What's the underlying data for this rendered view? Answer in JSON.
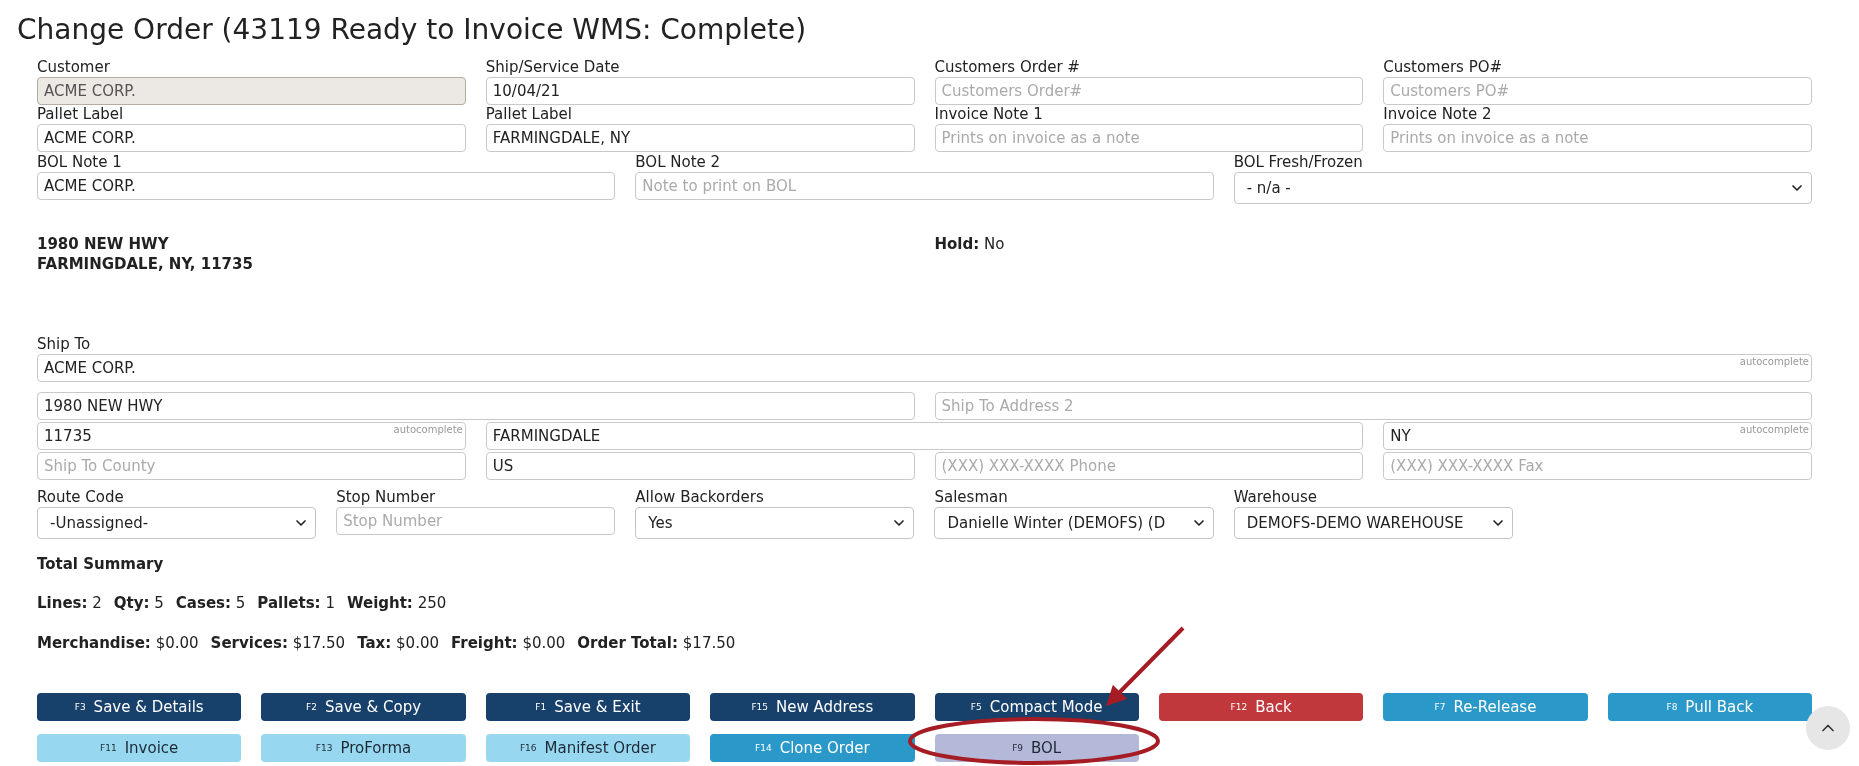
{
  "title": "Change Order (43119 Ready to Invoice WMS: Complete)",
  "form_rows": [
    {
      "fields": [
        {
          "kind": "input",
          "label": "Customer",
          "value": "ACME CORP.",
          "disabled": true
        },
        {
          "kind": "input",
          "label": "Ship/Service Date",
          "value": "10/04/21",
          "disabled": false
        },
        {
          "kind": "input",
          "label": "Customers Order #",
          "placeholder": "Customers Order#",
          "disabled": false
        },
        {
          "kind": "input",
          "label": "Customers PO#",
          "placeholder": "Customers PO#",
          "disabled": false
        }
      ]
    },
    {
      "fields": [
        {
          "kind": "input",
          "label": "Pallet Label",
          "value": "ACME CORP."
        },
        {
          "kind": "input",
          "label": "Pallet Label",
          "value": "FARMINGDALE, NY"
        },
        {
          "kind": "input",
          "label": "Invoice Note 1",
          "placeholder": "Prints on invoice as a note"
        },
        {
          "kind": "input",
          "label": "Invoice Note 2",
          "placeholder": "Prints on invoice as a note"
        }
      ]
    },
    {
      "fields": [
        {
          "kind": "input",
          "label": "BOL Note 1",
          "value": "ACME CORP."
        },
        {
          "kind": "input",
          "label": "BOL Note 2",
          "placeholder": "Note to print on BOL"
        },
        {
          "kind": "select",
          "label": "BOL Fresh/Frozen",
          "value": "- n/a -"
        }
      ]
    }
  ],
  "address": {
    "lines": [
      "1980 NEW HWY",
      "FARMINGDALE, NY, 11735"
    ]
  },
  "hold": {
    "label": "Hold:",
    "value": "No"
  },
  "ship_to": {
    "label": "Ship To",
    "rows": [
      {
        "fields": [
          {
            "kind": "input",
            "value": "ACME CORP.",
            "hint": "autocomplete"
          }
        ]
      },
      {
        "fields": [
          {
            "kind": "input",
            "value": "1980 NEW HWY"
          },
          {
            "kind": "input",
            "placeholder": "Ship To Address 2"
          }
        ]
      },
      {
        "fields": [
          {
            "kind": "input",
            "value": "11735",
            "hint": "autocomplete"
          },
          {
            "kind": "input",
            "value": "FARMINGDALE"
          },
          {
            "kind": "input",
            "value": "NY",
            "hint": "autocomplete"
          }
        ]
      },
      {
        "fields": [
          {
            "kind": "input",
            "placeholder": "Ship To County"
          },
          {
            "kind": "input",
            "value": "US"
          },
          {
            "kind": "input",
            "placeholder": "(XXX) XXX-XXXX Phone"
          },
          {
            "kind": "input",
            "placeholder": "(XXX) XXX-XXXX Fax"
          }
        ]
      }
    ]
  },
  "options_row": {
    "fields": [
      {
        "kind": "select",
        "label": "Route Code",
        "value": "-Unassigned-"
      },
      {
        "kind": "input",
        "label": "Stop Number",
        "placeholder": "Stop Number"
      },
      {
        "kind": "select",
        "label": "Allow Backorders",
        "value": "Yes"
      },
      {
        "kind": "select",
        "label": "Salesman",
        "value": "Danielle Winter (DEMOFS) (D"
      },
      {
        "kind": "select",
        "label": "Warehouse",
        "value": "DEMOFS-DEMO WAREHOUSE"
      }
    ]
  },
  "summary": {
    "title": "Total Summary",
    "lines": [
      {
        "items": [
          {
            "label": "Lines:",
            "value": "2"
          },
          {
            "label": "Qty:",
            "value": "5"
          },
          {
            "label": "Cases:",
            "value": "5"
          },
          {
            "label": "Pallets:",
            "value": "1"
          },
          {
            "label": "Weight:",
            "value": "250"
          }
        ]
      },
      {
        "items": [
          {
            "label": "Merchandise:",
            "value": "$0.00"
          },
          {
            "label": "Services:",
            "value": "$17.50"
          },
          {
            "label": "Tax:",
            "value": "$0.00"
          },
          {
            "label": "Freight:",
            "value": "$0.00"
          },
          {
            "label": "Order Total:",
            "value": "$17.50"
          }
        ]
      }
    ]
  },
  "buttons": [
    {
      "key": "F3",
      "label": "Save & Details",
      "kind": "primary"
    },
    {
      "key": "F2",
      "label": "Save & Copy",
      "kind": "primary"
    },
    {
      "key": "F1",
      "label": "Save & Exit",
      "kind": "primary"
    },
    {
      "key": "F15",
      "label": "New Address",
      "kind": "primary"
    },
    {
      "key": "F5",
      "label": "Compact Mode",
      "kind": "primary"
    },
    {
      "key": "F12",
      "label": "Back",
      "kind": "danger"
    },
    {
      "key": "F7",
      "label": "Re-Release",
      "kind": "info"
    },
    {
      "key": "F8",
      "label": "Pull Back",
      "kind": "info"
    },
    {
      "key": "F11",
      "label": "Invoice",
      "kind": "light"
    },
    {
      "key": "F13",
      "label": "ProForma",
      "kind": "light"
    },
    {
      "key": "F16",
      "label": "Manifest Order",
      "kind": "light"
    },
    {
      "key": "F14",
      "label": "Clone Order",
      "kind": "info"
    },
    {
      "key": "F9",
      "label": "BOL",
      "kind": "muted"
    }
  ]
}
